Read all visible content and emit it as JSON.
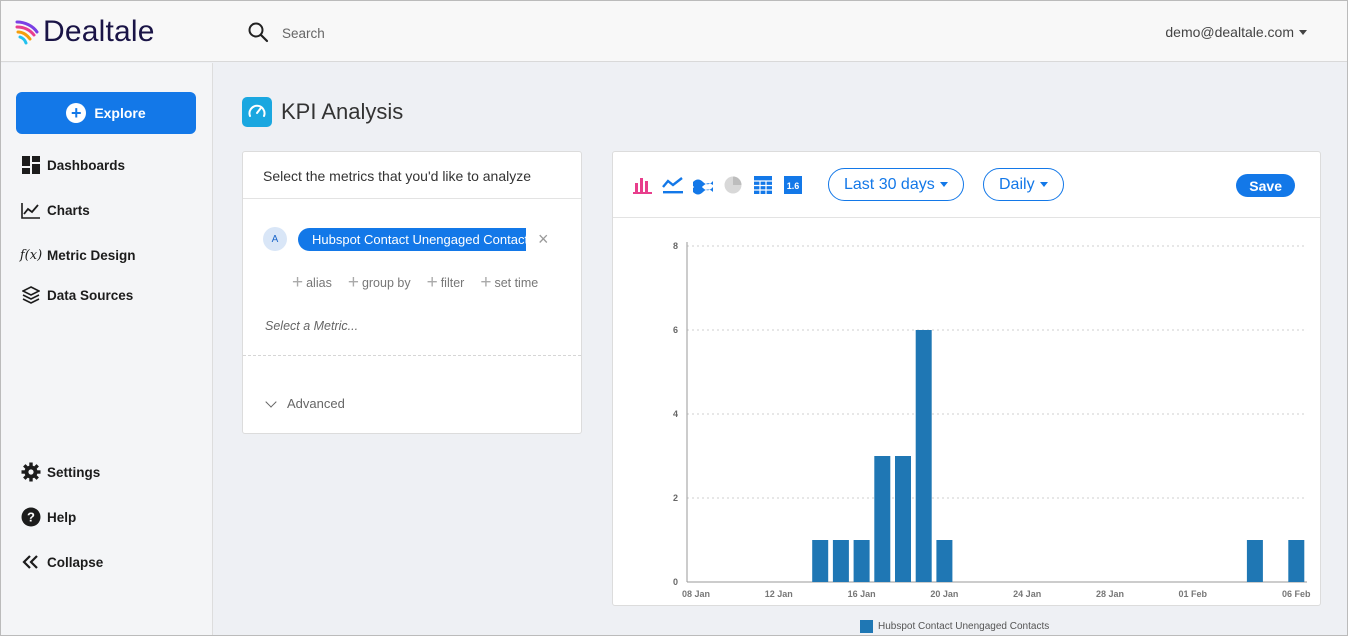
{
  "app": {
    "brand": "Dealtale",
    "search_placeholder": "Search",
    "user": "demo@dealtale.com"
  },
  "sidebar": {
    "explore": "Explore",
    "items": [
      {
        "label": "Dashboards",
        "icon": "dashboard-icon"
      },
      {
        "label": "Charts",
        "icon": "line-chart-icon"
      },
      {
        "label": "Metric Design",
        "icon": "function-icon"
      },
      {
        "label": "Data Sources",
        "icon": "layers-icon"
      }
    ],
    "bottom": [
      {
        "label": "Settings",
        "icon": "gear-icon"
      },
      {
        "label": "Help",
        "icon": "help-icon"
      },
      {
        "label": "Collapse",
        "icon": "collapse-icon"
      }
    ]
  },
  "page": {
    "title": "KPI Analysis",
    "title_icon": "gauge-icon"
  },
  "metrics_panel": {
    "header": "Select the metrics that you'd like to analyze",
    "metric_letter": "A",
    "metric_name": "Hubspot Contact Unengaged Contacts",
    "options": [
      "alias",
      "group by",
      "filter",
      "set time"
    ],
    "select_placeholder": "Select a Metric...",
    "advanced": "Advanced"
  },
  "chart_toolbar": {
    "chart_types": [
      "bar-chart-icon",
      "line-chart-icon",
      "area-chart-icon",
      "pie-chart-icon",
      "table-icon",
      "single-value-icon"
    ],
    "single_value_label": "1.6",
    "range": "Last 30 days",
    "granularity": "Daily",
    "save": "Save",
    "colors": {
      "accent": "#1378e8",
      "bar_icon": "#e83e8c",
      "series": "#1f77b4"
    }
  },
  "chart_data": {
    "type": "bar",
    "x": [
      "08 Jan",
      "09 Jan",
      "10 Jan",
      "11 Jan",
      "12 Jan",
      "13 Jan",
      "14 Jan",
      "15 Jan",
      "16 Jan",
      "17 Jan",
      "18 Jan",
      "19 Jan",
      "20 Jan",
      "21 Jan",
      "22 Jan",
      "23 Jan",
      "24 Jan",
      "25 Jan",
      "26 Jan",
      "27 Jan",
      "28 Jan",
      "29 Jan",
      "30 Jan",
      "31 Jan",
      "01 Feb",
      "02 Feb",
      "03 Feb",
      "04 Feb",
      "05 Feb",
      "06 Feb"
    ],
    "series": [
      {
        "name": "Hubspot Contact Unengaged Contacts",
        "values": [
          0,
          0,
          0,
          0,
          0,
          0,
          1,
          1,
          1,
          3,
          3,
          6,
          1,
          0,
          0,
          0,
          0,
          0,
          0,
          0,
          0,
          0,
          0,
          0,
          0,
          0,
          0,
          1,
          0,
          1
        ]
      }
    ],
    "xticks": [
      "08 Jan",
      "12 Jan",
      "16 Jan",
      "20 Jan",
      "24 Jan",
      "28 Jan",
      "01 Feb",
      "06 Feb"
    ],
    "yticks": [
      0,
      2,
      4,
      6,
      8
    ],
    "ylim": [
      0,
      8
    ],
    "grid": true,
    "legend": "bottom"
  }
}
